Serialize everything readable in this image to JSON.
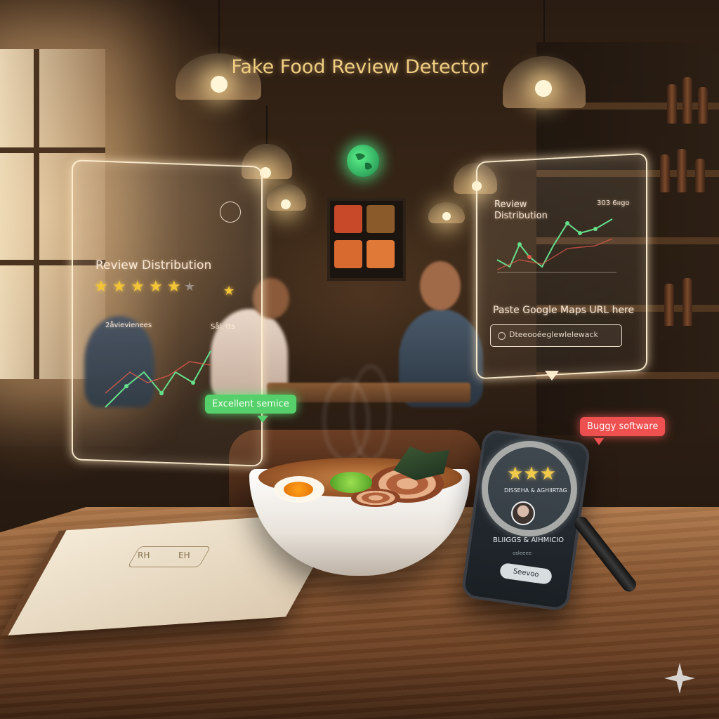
{
  "title": "Fake Food Review Detector",
  "left_panel": {
    "heading": "Review Distribution",
    "rating_stars": 5,
    "filled_stars": 5,
    "small_left": "2åvievienees",
    "small_right": "Sål. tts"
  },
  "right_panel": {
    "heading_line1": "Review",
    "heading_line2": "Distribution",
    "count_text": "303 6ııgo",
    "url_label": "Paste Google Maps URL here",
    "url_input_text": "Dteeooéeglewlelewack"
  },
  "bubbles": {
    "green": "Excellent semice",
    "red": "Buggy software"
  },
  "phone": {
    "stars": "★★★",
    "line1": "DISSEHA & AGHIIRTAG",
    "line2": "BLIIGGS & AIHMICIO",
    "small": "osleeee",
    "button": "Seevoo"
  },
  "menu_booklet": {
    "emblem_left": "RH",
    "emblem_right": "EH"
  },
  "icons": {
    "globe": "globe-icon",
    "badge": "chef-badge-icon",
    "star": "star-icon",
    "sparkle": "sparkle-icon"
  },
  "colors": {
    "title": "#f0cf82",
    "star": "#f4c534",
    "good_bubble": "#55d06a",
    "bad_bubble": "#ef5050"
  }
}
